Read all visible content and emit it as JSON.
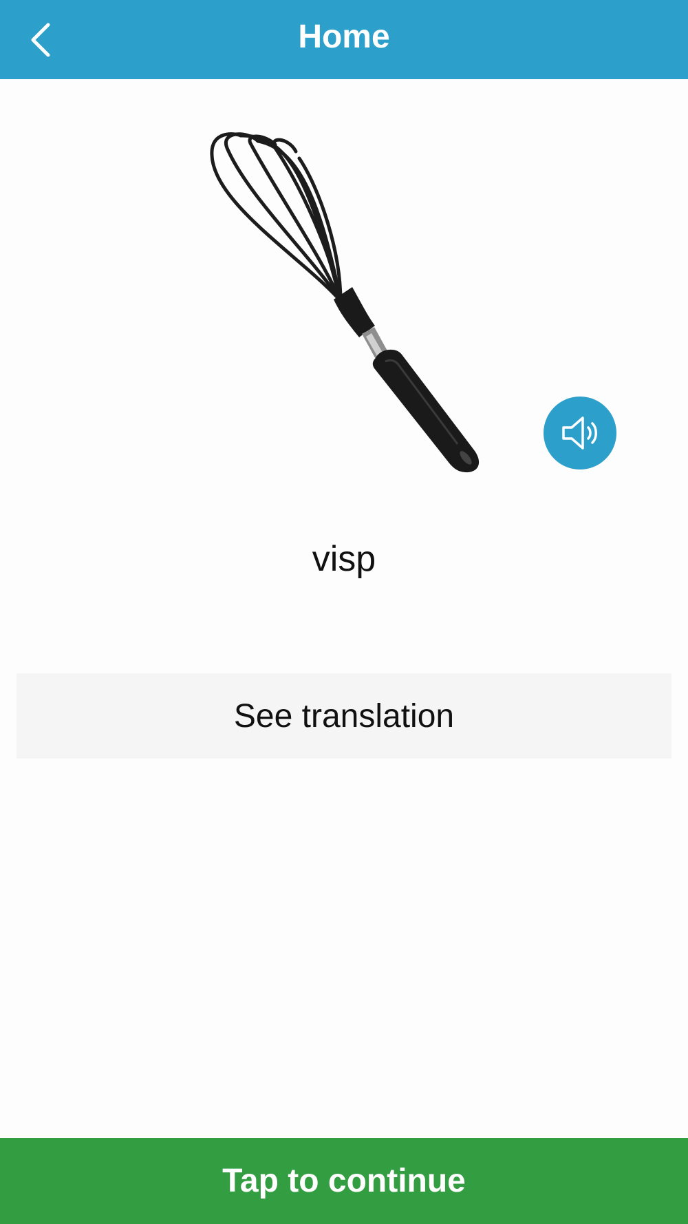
{
  "header": {
    "title": "Home",
    "back_icon": "chevron-left-icon",
    "color": "#2c9fcb"
  },
  "card": {
    "image_icon": "whisk-illustration",
    "speaker_icon": "speaker-icon",
    "word": "visp"
  },
  "actions": {
    "see_translation_label": "See translation",
    "continue_label": "Tap to continue",
    "continue_color": "#339e41"
  }
}
